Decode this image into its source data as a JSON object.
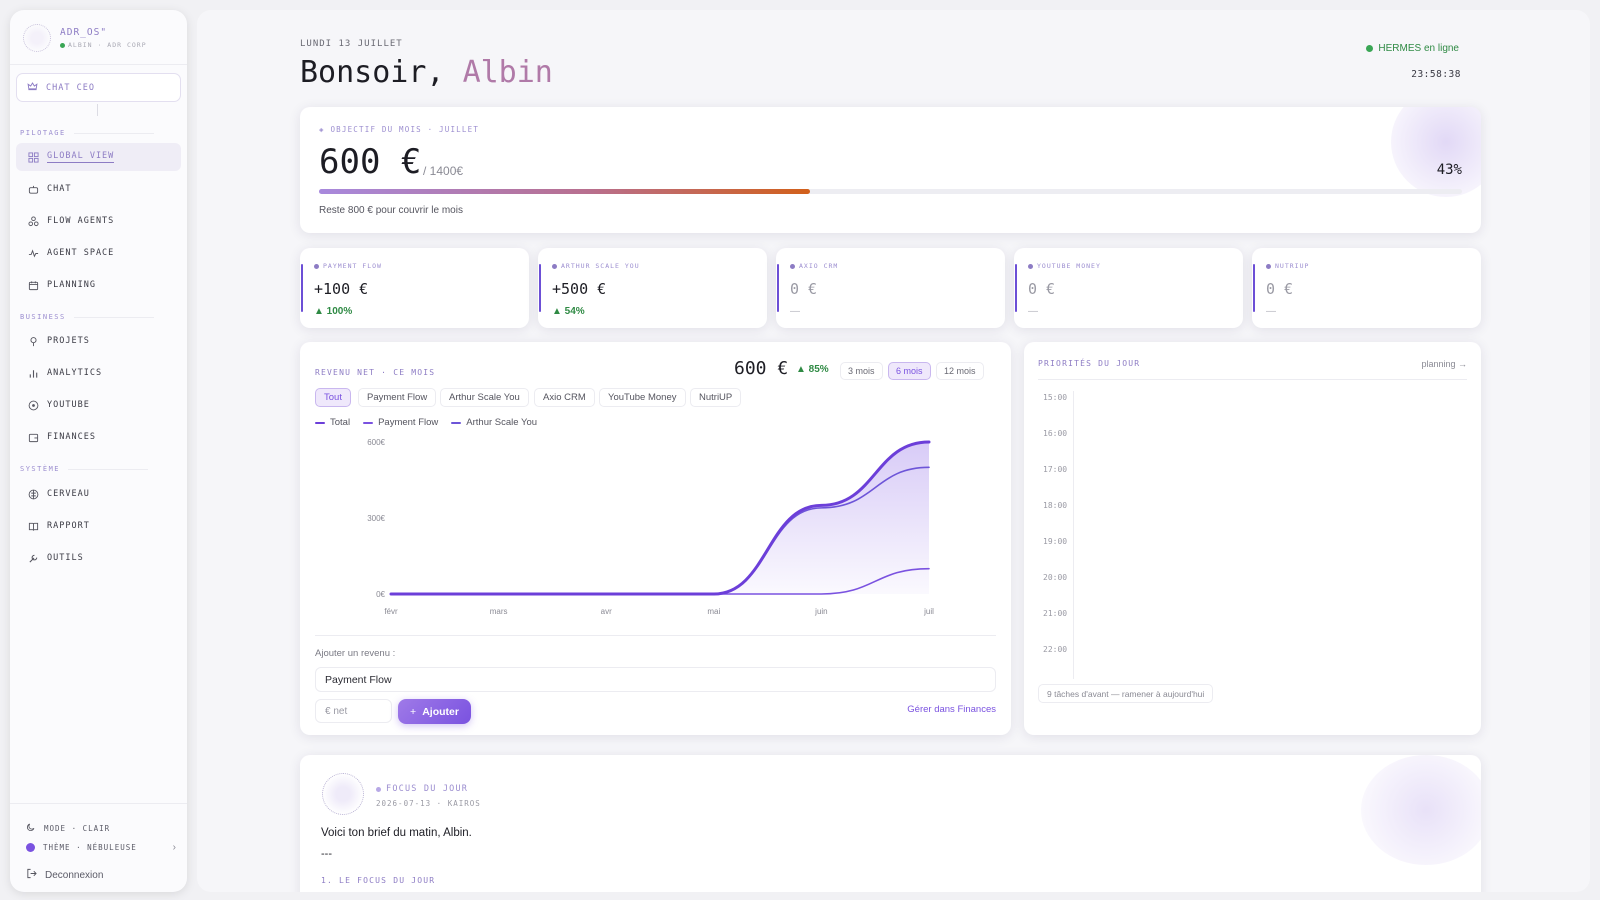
{
  "sidebar": {
    "brand": {
      "name": "ADR_OS\"",
      "sub": "ALBIN · ADR CORP"
    },
    "chat_ceo": "CHAT CEO",
    "sections": {
      "pilotage": "PILOTAGE",
      "business": "BUSINESS",
      "systeme": "SYSTÈME"
    },
    "items": [
      {
        "label": "GLOBAL VIEW",
        "icon": "grid-icon",
        "active": true
      },
      {
        "label": "CHAT",
        "icon": "chat-bot-icon"
      },
      {
        "label": "FLOW AGENTS",
        "icon": "agents-icon"
      },
      {
        "label": "AGENT SPACE",
        "icon": "pulse-icon"
      },
      {
        "label": "PLANNING",
        "icon": "calendar-icon"
      },
      {
        "label": "PROJETS",
        "icon": "pin-icon"
      },
      {
        "label": "ANALYTICS",
        "icon": "bar-chart-icon"
      },
      {
        "label": "YOUTUBE",
        "icon": "play-circle-icon"
      },
      {
        "label": "FINANCES",
        "icon": "wallet-icon"
      },
      {
        "label": "CERVEAU",
        "icon": "brain-icon"
      },
      {
        "label": "RAPPORT",
        "icon": "book-icon"
      },
      {
        "label": "OUTILS",
        "icon": "wrench-icon"
      }
    ],
    "mode": "MODE · CLAIR",
    "theme": "THÈME · NÉBULEUSE",
    "logout": "Deconnexion"
  },
  "header": {
    "date": "LUNDI 13 JUILLET",
    "greeting": "Bonsoir,",
    "name": "Albin",
    "status": "HERMES en ligne",
    "clock": "23:58:38"
  },
  "objective": {
    "label": "OBJECTIF DU MOIS · JUILLET",
    "amount": "600 €",
    "total": "/ 1400€",
    "percent": "43%",
    "progress": 0.43,
    "remaining": "Reste 800 € pour couvrir le mois"
  },
  "streams": [
    {
      "name": "PAYMENT FLOW",
      "value": "+100 €",
      "delta": "▲ 100%"
    },
    {
      "name": "ARTHUR SCALE YOU",
      "value": "+500 €",
      "delta": "▲ 54%"
    },
    {
      "name": "AXIO CRM",
      "value": "0 €",
      "delta": "—"
    },
    {
      "name": "YOUTUBE MONEY",
      "value": "0 €",
      "delta": "—"
    },
    {
      "name": "NUTRIUP",
      "value": "0 €",
      "delta": "—"
    }
  ],
  "revenue": {
    "label": "REVENU NET · CE MOIS",
    "amount": "600 €",
    "delta": "▲ 85%",
    "ranges": [
      "3 mois",
      "6 mois",
      "12 mois"
    ],
    "active_range": "6 mois",
    "filters": [
      "Tout",
      "Payment Flow",
      "Arthur Scale You",
      "Axio CRM",
      "YouTube Money",
      "NutriUP"
    ],
    "active_filter": "Tout",
    "add_label": "Ajouter un revenu :",
    "select_value": "Payment Flow",
    "input_placeholder": "€ net",
    "add_button": "Ajouter",
    "manage_link": "Gérer dans Finances"
  },
  "chart_data": {
    "type": "line",
    "categories": [
      "févr",
      "mars",
      "avr",
      "mai",
      "juin",
      "juil"
    ],
    "y_ticks": [
      "0€",
      "300€",
      "600€"
    ],
    "ylim": [
      0,
      600
    ],
    "legend_placement": "top-left",
    "series": [
      {
        "name": "Total",
        "values": [
          0,
          0,
          0,
          0,
          350,
          600
        ],
        "color": "#6c3fd9"
      },
      {
        "name": "Payment Flow",
        "values": [
          0,
          0,
          0,
          0,
          0,
          100
        ],
        "color": "#7a52e0"
      },
      {
        "name": "Arthur Scale You",
        "values": [
          0,
          0,
          0,
          0,
          340,
          500
        ],
        "color": "#6d55d8"
      }
    ]
  },
  "priorities": {
    "label": "PRIORITÉS DU JOUR",
    "link": "planning →",
    "slots": [
      "15:00",
      "16:00",
      "17:00",
      "18:00",
      "19:00",
      "20:00",
      "21:00",
      "22:00"
    ],
    "footer": "9 tâches d'avant — ramener à aujourd'hui"
  },
  "focus": {
    "label": "FOCUS DU JOUR",
    "meta": "2026-07-13 · KAIROS",
    "brief": "Voici ton brief du matin, Albin.",
    "separator": "---",
    "heading": "1. LE FOCUS DU JOUR"
  },
  "colors": {
    "accent": "#7a52e0",
    "success": "#2f8a44",
    "brand_label": "#8d7cc4"
  }
}
